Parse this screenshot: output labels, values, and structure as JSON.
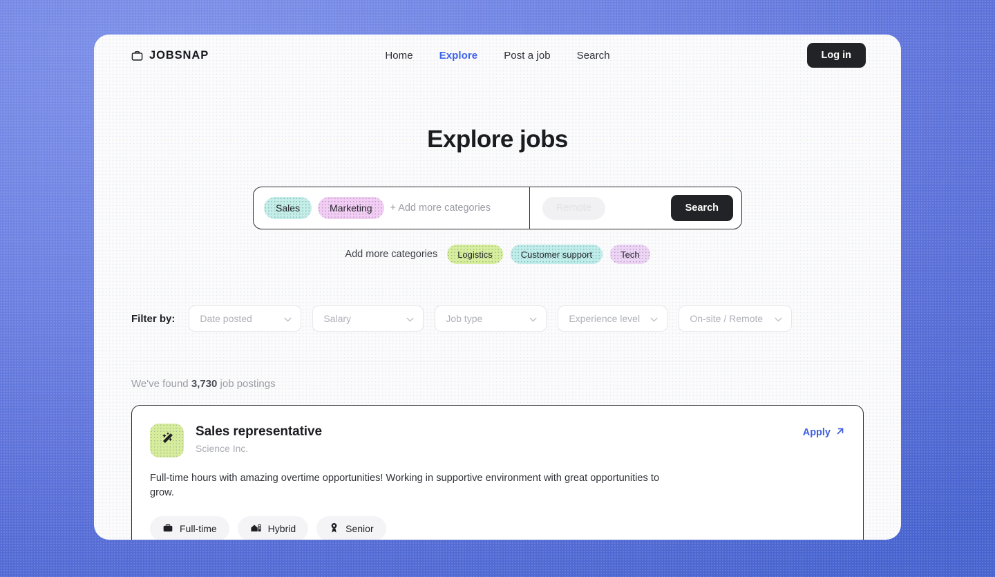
{
  "header": {
    "brand": "JOBSNAP",
    "brand_icon": "briefcase-icon",
    "nav": [
      {
        "label": "Home",
        "active": false
      },
      {
        "label": "Explore",
        "active": true
      },
      {
        "label": "Post a job",
        "active": false
      },
      {
        "label": "Search",
        "active": false
      }
    ],
    "login_label": "Log in"
  },
  "hero": {
    "title": "Explore jobs"
  },
  "search": {
    "selected_categories": [
      {
        "label": "Sales",
        "color": "#c4eee8"
      },
      {
        "label": "Marketing",
        "color": "#f3cdf4"
      }
    ],
    "add_more_inline": "+ Add more categories",
    "location_placeholder": "Remote",
    "search_button": "Search"
  },
  "suggestions": {
    "label": "Add more categories",
    "chips": [
      {
        "label": "Logistics",
        "color": "#d7ef9c"
      },
      {
        "label": "Customer support",
        "color": "#bfeeea"
      },
      {
        "label": "Tech",
        "color": "#eed4f5"
      }
    ]
  },
  "filters": {
    "label": "Filter by:",
    "items": [
      {
        "label": "Date posted"
      },
      {
        "label": "Salary"
      },
      {
        "label": "Job type"
      },
      {
        "label": "Experience level"
      },
      {
        "label": "On-site / Remote"
      }
    ]
  },
  "results": {
    "prefix": "We've found ",
    "count": "3,730",
    "suffix": " job postings"
  },
  "job": {
    "logo_icon": "magic-wand-icon",
    "logo_color": "#d7ed9c",
    "title": "Sales representative",
    "company": "Science Inc.",
    "apply_label": "Apply",
    "apply_icon": "arrow-up-right-icon",
    "description": "Full-time hours with amazing overtime opportunities! Working in supportive environment with great opportunities to grow.",
    "tags": [
      {
        "label": "Full-time",
        "icon": "briefcase-icon"
      },
      {
        "label": "Hybrid",
        "icon": "house-icon"
      },
      {
        "label": "Senior",
        "icon": "medal-icon"
      }
    ]
  },
  "theme": {
    "background": "#6b80e0",
    "accent": "#3c63e8",
    "dark": "#222326"
  }
}
